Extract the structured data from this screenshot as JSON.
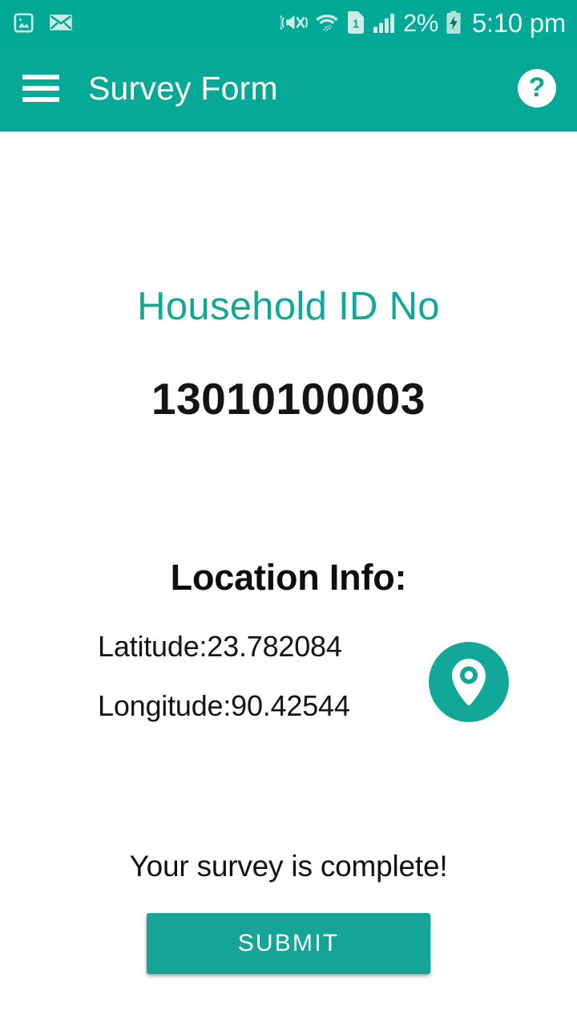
{
  "theme": {
    "primary": "#06a896",
    "status_bar_bg": "#00a896",
    "accent_text": "#10a896",
    "button_bg": "#15a596",
    "on_primary": "#ffffff",
    "body_text": "#141414",
    "page_bg": "#ffffff"
  },
  "status_bar": {
    "left_icons": [
      {
        "name": "photo-icon",
        "glyph": "image"
      },
      {
        "name": "mail-icon",
        "glyph": "envelope"
      }
    ],
    "right_icons": [
      {
        "name": "volume-mute-vibrate-icon",
        "glyph": "speaker-muted"
      },
      {
        "name": "wifi-icon",
        "glyph": "wifi-transfer"
      },
      {
        "name": "sim-card-icon",
        "glyph": "sim-1",
        "label": "1"
      },
      {
        "name": "signal-bars-icon",
        "glyph": "cellular-signal"
      }
    ],
    "battery_percent": "2%",
    "battery_state": "charging",
    "clock": "5:10 pm"
  },
  "app_bar": {
    "menu_icon": "hamburger-menu-icon",
    "title": "Survey Form",
    "help_icon": "help-question-icon",
    "help_glyph": "?"
  },
  "main": {
    "household_label": "Household ID No",
    "household_value": "13010100003",
    "location_heading": "Location Info:",
    "latitude_text": "Latitude:23.782084",
    "longitude_text": "Longitude:90.42544",
    "latitude_value": "23.782084",
    "longitude_value": "90.42544",
    "map_pin_icon": "map-pin-icon",
    "completion_message": "Your survey is complete!",
    "submit_label": "SUBMIT"
  }
}
